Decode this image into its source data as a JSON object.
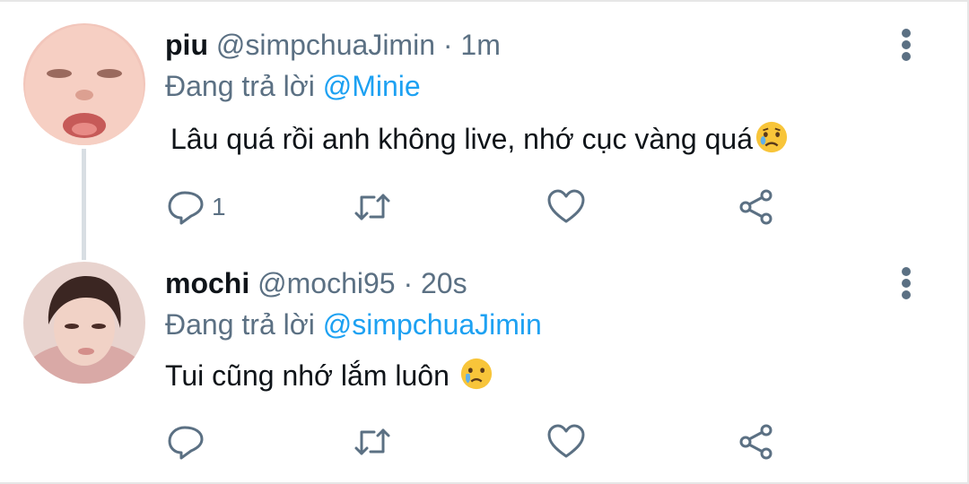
{
  "tweets": [
    {
      "name": "piu",
      "handle": "@simpchuaJimin",
      "separator": "·",
      "time": "1m",
      "replying_prefix": "Đang trả lời",
      "replying_to": "@Minie",
      "text": "Lâu quá rồi anh không live, nhớ cục vàng quá",
      "emoji": "sad-face-emoji",
      "reply_count": "1"
    },
    {
      "name": "mochi",
      "handle": "@mochi95",
      "separator": "·",
      "time": "20s",
      "replying_prefix": "Đang trả lời",
      "replying_to": "@simpchuaJimin",
      "text": "Tui cũng nhớ lắm luôn ",
      "emoji": "crying-face-emoji",
      "reply_count": ""
    }
  ],
  "colors": {
    "text": "#0f1419",
    "muted": "#5b7083",
    "accent": "#1da1f2",
    "thread_line": "#d8dee3"
  },
  "icons": [
    "reply-icon",
    "retweet-icon",
    "like-icon",
    "share-icon",
    "more-options-icon"
  ]
}
